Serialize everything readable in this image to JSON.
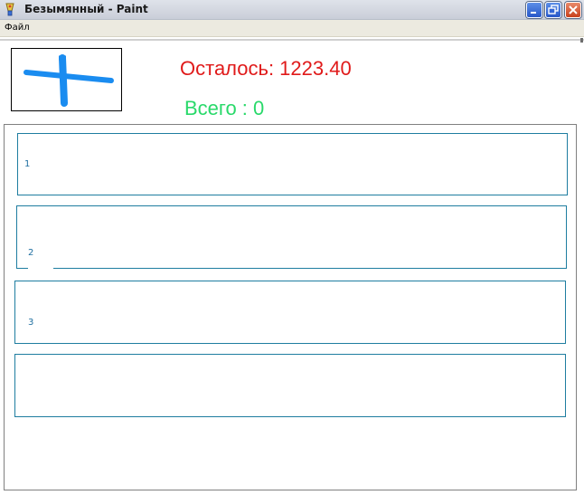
{
  "window": {
    "title": "Безымянный - Paint",
    "icon": "paint-app-icon",
    "controls": [
      "minimize-icon",
      "restore-icon",
      "close-icon"
    ]
  },
  "menu": {
    "items": [
      {
        "label": "Файл"
      }
    ]
  },
  "stats": {
    "remaining_text": "Осталось: 1223.40",
    "total_text": "Всего : 0",
    "remaining_color": "#e01a1a",
    "total_color": "#29d96a"
  },
  "preview": {
    "stroke_color": "#1a8cf0"
  },
  "slots": [
    {
      "label": "1"
    },
    {
      "label": "2"
    },
    {
      "label": "3"
    },
    {
      "label": ""
    }
  ]
}
